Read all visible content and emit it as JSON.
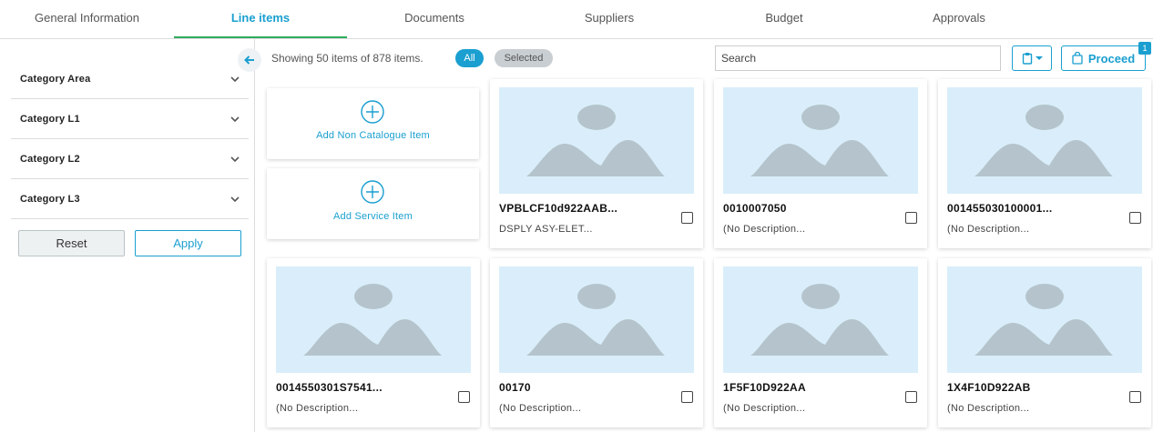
{
  "tabs": [
    {
      "label": "General Information"
    },
    {
      "label": "Line items"
    },
    {
      "label": "Documents"
    },
    {
      "label": "Suppliers"
    },
    {
      "label": "Budget"
    },
    {
      "label": "Approvals"
    }
  ],
  "sidebar": {
    "categories": [
      {
        "label": "Category Area"
      },
      {
        "label": "Category L1"
      },
      {
        "label": "Category L2"
      },
      {
        "label": "Category L3"
      }
    ],
    "reset_label": "Reset",
    "apply_label": "Apply"
  },
  "toolbar": {
    "showing_text": "Showing 50 items of 878 items.",
    "filter_all": "All",
    "filter_selected": "Selected",
    "search_placeholder": "Search",
    "proceed_label": "Proceed",
    "proceed_badge": "1"
  },
  "add_cards": [
    {
      "label": "Add Non Catalogue Item"
    },
    {
      "label": "Add Service Item"
    }
  ],
  "items": [
    {
      "code": "VPBLCF10d922AAB...",
      "description": "DSPLY ASY-ELET..."
    },
    {
      "code": "0010007050",
      "description": "(No Description..."
    },
    {
      "code": "001455030100001...",
      "description": "(No Description..."
    },
    {
      "code": "0014550301S7541...",
      "description": "(No Description..."
    },
    {
      "code": "00170",
      "description": "(No Description..."
    },
    {
      "code": "1F5F10D922AA",
      "description": "(No Description..."
    },
    {
      "code": "1X4F10D922AB",
      "description": "(No Description..."
    }
  ],
  "colors": {
    "accent": "#1a9fd0",
    "active_tab_underline": "#2eaa5c",
    "placeholder_bg": "#d9eefa",
    "placeholder_shape": "#b5c4cc"
  }
}
